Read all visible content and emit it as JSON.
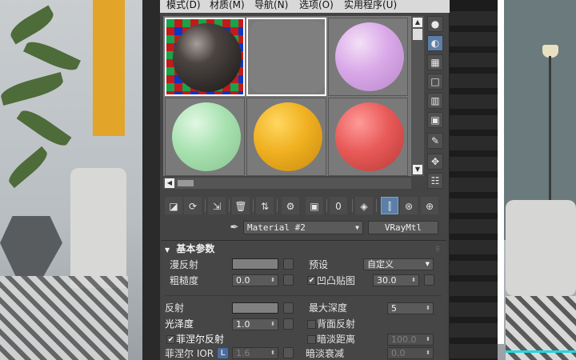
{
  "menubar": {
    "items": [
      "模式(D)",
      "材质(M)",
      "导航(N)",
      "选项(O)",
      "实用程序(U)"
    ]
  },
  "sample_slots": [
    {
      "material": "dark-reflective",
      "color": "#3e3a38",
      "selected": true,
      "checker_bg": true
    },
    {
      "material": "gray-flat",
      "color": "#808080",
      "selected": true,
      "checker_bg": false
    },
    {
      "material": "pink",
      "color": "#d9a8e8",
      "selected": false,
      "checker_bg": false
    },
    {
      "material": "mint-green",
      "color": "#a8e2b0",
      "selected": false,
      "checker_bg": false
    },
    {
      "material": "yellow",
      "color": "#f0b020",
      "selected": false,
      "checker_bg": false
    },
    {
      "material": "red",
      "color": "#e85a58",
      "selected": false,
      "checker_bg": false
    }
  ],
  "material": {
    "name": "Material #2",
    "type": "VRayMtl"
  },
  "rollout": {
    "title": "基本参数",
    "diffuse_label": "漫反射",
    "roughness_label": "粗糙度",
    "roughness_value": "0.0",
    "preset_label": "预设",
    "preset_value": "自定义",
    "bump_label": "凹凸贴图",
    "bump_checked": true,
    "bump_value": "30.0",
    "reflect_label": "反射",
    "max_depth_label": "最大深度",
    "max_depth_value": "5",
    "glossiness_label": "光泽度",
    "glossiness_value": "1.0",
    "backside_label": "背面反射",
    "fresnel_label": "菲涅尔反射",
    "fresnel_checked": true,
    "dim_distance_label": "暗淡距离",
    "dim_distance_value": "100.0",
    "fresnel_ior_label": "菲涅尔 IOR",
    "fresnel_ior_lock": "L",
    "fresnel_ior_value": "1.6",
    "dim_falloff_label": "暗淡衰减",
    "dim_falloff_value": "0.0"
  },
  "colors": {
    "accent_blue": "#5b7fa8",
    "swatch_gray": "#808080"
  }
}
